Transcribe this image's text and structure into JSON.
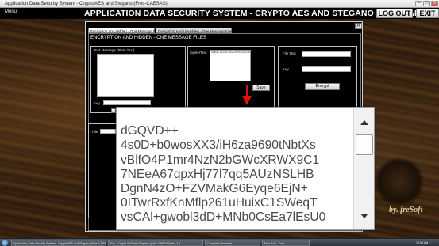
{
  "window": {
    "title": "Application Data Security System - Crypto AES and Stegano (Fres-CAESAS)"
  },
  "app": {
    "menu_label": "Menu",
    "title": "APPLICATION DATA SECURITY SYSTEM - CRYPTO AES AND STEGANO ( Fres-CAESAS )",
    "logout_label": "LOG OUT",
    "exit_label": "EXIT"
  },
  "dialog": {
    "close_label": "X",
    "tabs": [
      {
        "label": "Encryption And Hidden - One Message Files"
      },
      {
        "label": "Decryption And UnHidden - One Message Files"
      }
    ],
    "heading": "ENCRYPTION AND HIDDEN - ONE MESSAGE FILES",
    "text_message_label": "Text Message (Plain Text)",
    "key_label": "Key",
    "cipher_label": "CipherText",
    "file_text_label": "File Text",
    "key_label_2": "Key",
    "encrypt_label": "Encrypt",
    "save_label": "Save",
    "file_label": "File",
    "cipher_preview": "dGQVD++4s0D+b0wosXX3/iH6za9690tNbtXsvBlfO4P1mr4NzN2bGWcXRWX9C17NEeA67qpxHj77l7qq5AUzNSLHBDgnN4zO+FZVMakG6Eyqe6EjN+0ITwrRxfKnMflp261uHuixC1SWeqT"
  },
  "zoom": {
    "lines": [
      "dGQVD++",
      "4s0D+b0wosXX3/iH6za9690tNbtXs",
      "vBlfO4P1mr4NzN2bGWcXRWX9C1",
      "7NEeA67qpxHj77l7qq5AUzNSLHB",
      "DgnN4zO+FZVMakG6Eyqe6EjN+",
      "0ITwrRxfKnMflp261uHuixC1SWeqT",
      "vsCAl+gwobl3dD+MNb0CsEa7lEsU0"
    ]
  },
  "watermark": "by. freSoft",
  "taskbar": {
    "items": [
      {
        "label": "Application Data Security System - Crypto AES and Stegano (Fres-CAESAS)"
      },
      {
        "label": "Enc - Crypto AES and Stegano (Fres-CAESAS) Ver 1.0"
      },
      {
        "label": "Camtasia Recorder"
      },
      {
        "label": "Fres Soft - Cam"
      },
      {
        "label": "10:05 AM"
      }
    ]
  }
}
